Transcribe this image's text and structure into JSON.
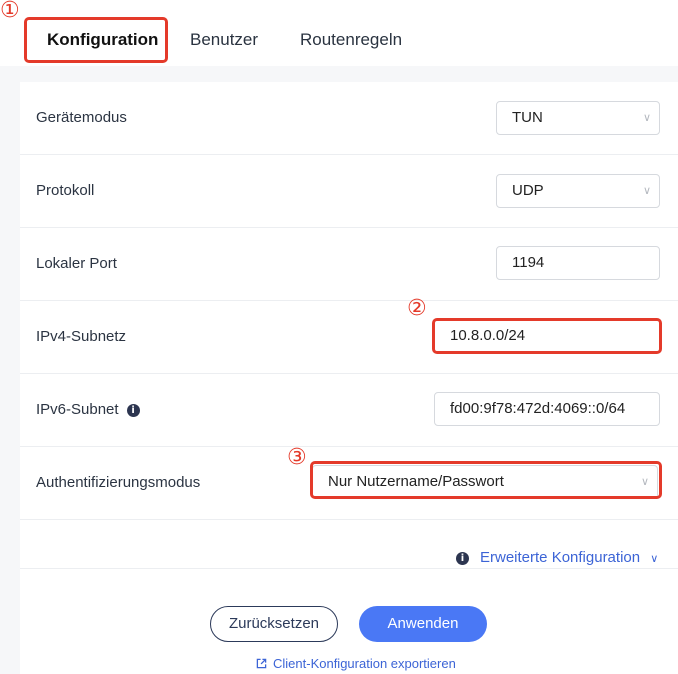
{
  "tabs": [
    {
      "label": "Konfiguration",
      "active": true
    },
    {
      "label": "Benutzer",
      "active": false
    },
    {
      "label": "Routenregeln",
      "active": false
    }
  ],
  "annotations": {
    "marker_1": "①",
    "marker_2": "②",
    "marker_3": "③"
  },
  "form": {
    "device_mode": {
      "label": "Gerätemodus",
      "value": "TUN"
    },
    "protocol": {
      "label": "Protokoll",
      "value": "UDP"
    },
    "local_port": {
      "label": "Lokaler Port",
      "value": "1194"
    },
    "ipv4_subnet": {
      "label": "IPv4-Subnetz",
      "value": "10.8.0.0/24"
    },
    "ipv6_subnet": {
      "label": "IPv6-Subnet",
      "value": "fd00:9f78:472d:4069::0/64",
      "info_icon": "i"
    },
    "auth_mode": {
      "label": "Authentifizierungsmodus",
      "value": "Nur Nutzername/Passwort"
    }
  },
  "advanced": {
    "label": "Erweiterte Konfiguration",
    "icon": "i",
    "chevron": "∨"
  },
  "buttons": {
    "reset": "Zurücksetzen",
    "apply": "Anwenden"
  },
  "export": {
    "label": "Client-Konfiguration exportieren"
  },
  "select_chevron": "∨",
  "colors": {
    "accent": "#4a78f5",
    "highlight": "#e43a2a",
    "link": "#3c64d6"
  }
}
